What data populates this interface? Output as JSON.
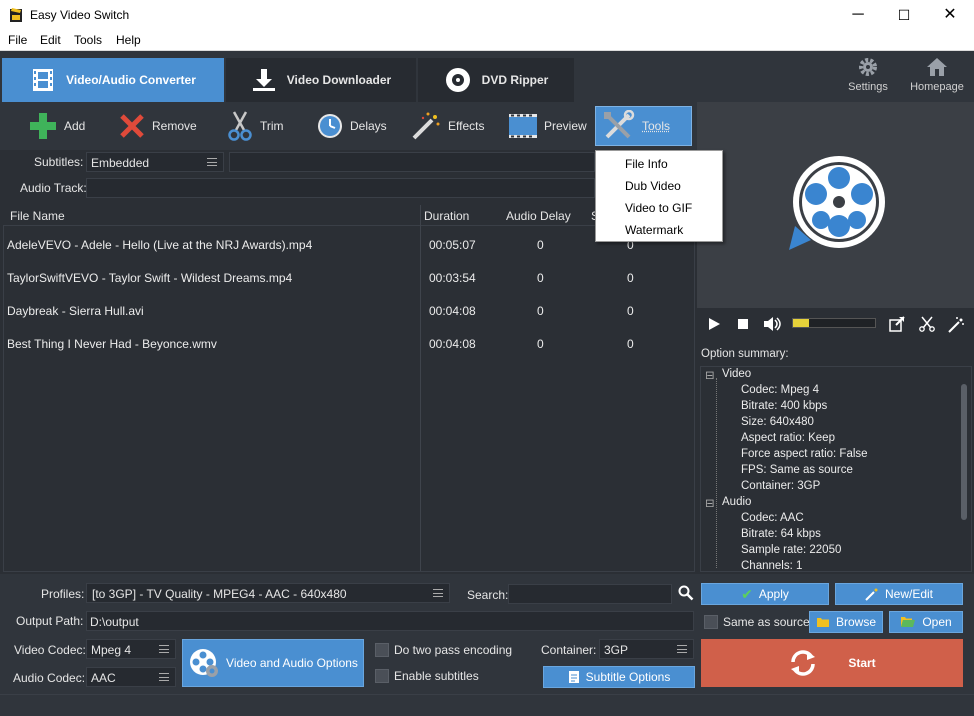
{
  "window": {
    "title": "Easy Video Switch",
    "min_glyph": "─",
    "max_glyph": "☐",
    "close_glyph": "✕"
  },
  "menu": {
    "items": [
      "File",
      "Edit",
      "Tools",
      "Help"
    ]
  },
  "tabs": [
    {
      "label": "Video/Audio Converter",
      "active": true
    },
    {
      "label": "Video Downloader",
      "active": false
    },
    {
      "label": "DVD Ripper",
      "active": false
    }
  ],
  "top_right": {
    "settings": "Settings",
    "homepage": "Homepage"
  },
  "toolbar": {
    "add": "Add",
    "remove": "Remove",
    "trim": "Trim",
    "delays": "Delays",
    "effects": "Effects",
    "preview": "Preview",
    "tools": "Tools"
  },
  "subtitles": {
    "label": "Subtitles:",
    "value": "Embedded"
  },
  "audio_track": {
    "label": "Audio Track:"
  },
  "table": {
    "headers": {
      "file_name": "File Name",
      "duration": "Duration",
      "audio_delay": "Audio Delay",
      "partial": "S"
    },
    "rows": [
      {
        "file": "AdeleVEVO - Adele - Hello (Live at the NRJ Awards).mp4",
        "duration": "00:05:07",
        "delay": "0",
        "sub_delay": "0"
      },
      {
        "file": "TaylorSwiftVEVO - Taylor Swift - Wildest Dreams.mp4",
        "duration": "00:03:54",
        "delay": "0",
        "sub_delay": "0"
      },
      {
        "file": "Daybreak - Sierra Hull.avi",
        "duration": "00:04:08",
        "delay": "0",
        "sub_delay": "0"
      },
      {
        "file": "Best Thing I Never Had - Beyonce.wmv",
        "duration": "00:04:08",
        "delay": "0",
        "sub_delay": "0"
      }
    ]
  },
  "tools_menu": {
    "items": [
      "File Info",
      "Dub Video",
      "Video to GIF",
      "Watermark"
    ]
  },
  "player": {
    "volume_fraction": 0.2
  },
  "summary": {
    "title": "Option summary:",
    "video_group": "Video",
    "video_items": [
      "Codec: Mpeg 4",
      "Bitrate: 400 kbps",
      "Size: 640x480",
      "Aspect ratio: Keep",
      "Force aspect ratio: False",
      "FPS: Same as source",
      "Container: 3GP"
    ],
    "audio_group": "Audio",
    "audio_items": [
      "Codec: AAC",
      "Bitrate: 64 kbps",
      "Sample rate: 22050",
      "Channels: 1"
    ],
    "tree_minus": "⊟"
  },
  "bottom": {
    "profiles_label": "Profiles:",
    "profiles_value": "[to 3GP] - TV Quality - MPEG4 - AAC - 640x480",
    "search_label": "Search:",
    "search_value": "",
    "apply": "Apply",
    "new_edit": "New/Edit",
    "output_label": "Output Path:",
    "output_value": "D:\\output",
    "same_as_source": "Same as source",
    "browse": "Browse",
    "open": "Open",
    "video_codec_label": "Video Codec:",
    "video_codec_value": "Mpeg 4",
    "audio_codec_label": "Audio Codec:",
    "audio_codec_value": "AAC",
    "va_options": "Video and Audio Options",
    "two_pass": "Do two pass encoding",
    "enable_subs": "Enable subtitles",
    "container_label": "Container:",
    "container_value": "3GP",
    "subtitle_options": "Subtitle Options",
    "start": "Start"
  },
  "colors": {
    "accent": "#4a8fd1",
    "start": "#d0604a",
    "panel": "#30353c",
    "background": "#2b2f35"
  }
}
